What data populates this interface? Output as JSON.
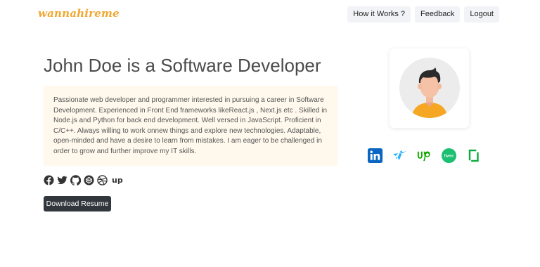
{
  "brand": {
    "logo_text": "wannahireme",
    "accent": "#f0a830"
  },
  "nav": {
    "how_label": "How it Works ?",
    "feedback_label": "Feedback",
    "logout_label": "Logout"
  },
  "profile": {
    "title": "John Doe is a Software Developer",
    "bio": "Passionate web developer and programmer interested in pursuing a career in Software Development. Experienced in Front End frameworks likeReact.js , Next.js etc . Skilled in Node.js and Python for back end development. Well versed in JavaScript. Proficient in C/C++. Always willing to work onnew things and explore new technologies. Adaptable, open-minded and have a desire to learn from mistakes. I am eager to be challenged in order to grow and further improve my IT skills.",
    "download_label": "Download Resume"
  },
  "social_icons": [
    "facebook-icon",
    "twitter-icon",
    "github-icon",
    "codepen-icon",
    "dribbble-icon",
    "upwork-icon"
  ],
  "social_upwork_text": "up",
  "platform_icons": [
    "linkedin-icon",
    "freelancer-icon",
    "upwork-icon",
    "fiverr-icon",
    "glassdoor-icon"
  ],
  "platforms": {
    "fiverr_text": "fiverr"
  },
  "colors": {
    "linkedin": "#0a66c2",
    "freelancer": "#29b2fe",
    "upwork": "#14a800",
    "fiverr": "#1dbf73",
    "glassdoor": "#0caa41",
    "download_bg": "#32373d",
    "bio_bg": "#fff9ed"
  }
}
